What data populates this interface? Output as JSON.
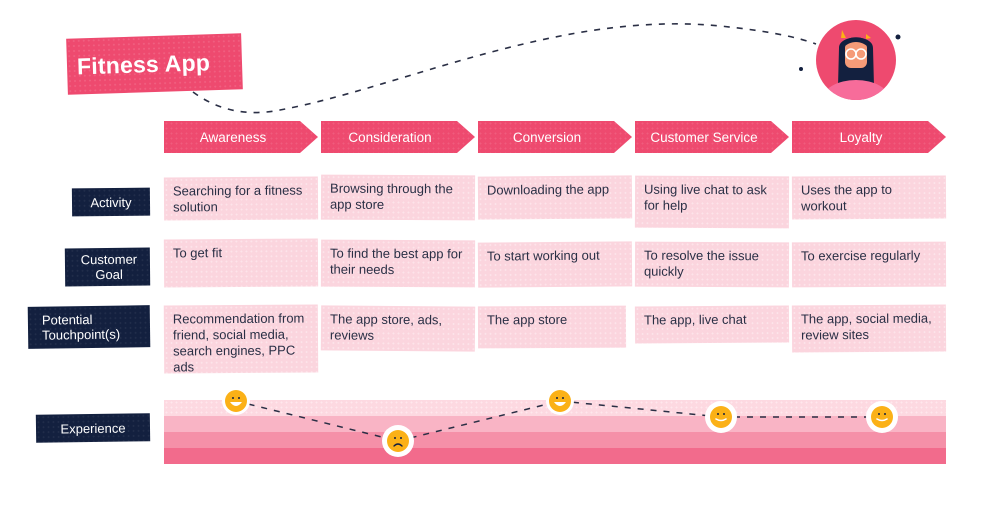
{
  "title": "Fitness App",
  "colors": {
    "accent": "#ee4a6f",
    "navy": "#13203f",
    "card": "#fbd5de",
    "experience_bands": [
      "#fdd9e1",
      "#f9b4c5",
      "#f590a8",
      "#f26b8c"
    ],
    "emoji": "#fbb117"
  },
  "persona": {
    "icon": "avatar-persona-icon"
  },
  "stages": [
    {
      "label": "Awareness"
    },
    {
      "label": "Consideration"
    },
    {
      "label": "Conversion"
    },
    {
      "label": "Customer Service"
    },
    {
      "label": "Loyalty"
    }
  ],
  "rows": [
    {
      "label": "Activity",
      "cells": [
        "Searching for a fitness solution",
        "Browsing through the app store",
        "Downloading the app",
        "Using live chat to ask for help",
        "Uses the app to workout"
      ]
    },
    {
      "label": "Customer Goal",
      "cells": [
        "To get fit",
        "To find the best app for their needs",
        "To start working out",
        "To resolve the issue quickly",
        "To exercise regularly"
      ]
    },
    {
      "label": "Potential Touchpoint(s)",
      "cells": [
        "Recommendation from friend, social media, search engines, PPC ads",
        "The app store, ads, reviews",
        "The app store",
        "The app, live chat",
        "The app, social media, review sites"
      ]
    }
  ],
  "experience": {
    "label": "Experience",
    "levels_scale": "0 = best (top band), 3 = worst (bottom band)",
    "points": [
      {
        "stage": "Awareness",
        "mood": "happy",
        "level": 0.0
      },
      {
        "stage": "Consideration",
        "mood": "sad",
        "level": 2.5
      },
      {
        "stage": "Conversion",
        "mood": "happy",
        "level": 0.0
      },
      {
        "stage": "Customer Service",
        "mood": "content",
        "level": 1.0
      },
      {
        "stage": "Loyalty",
        "mood": "content",
        "level": 1.0
      }
    ]
  }
}
